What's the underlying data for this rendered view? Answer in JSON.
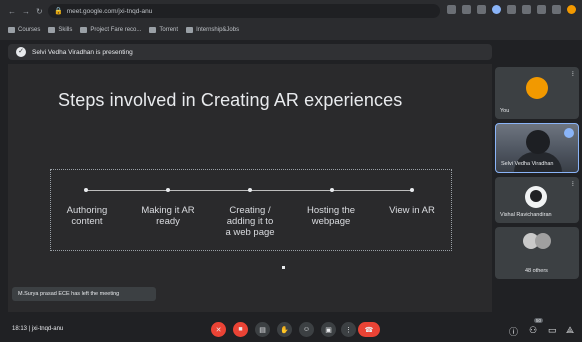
{
  "browser": {
    "url": "meet.google.com/jxi-tnqd-anu",
    "bookmarks": [
      "Courses",
      "Skills",
      "Project Fare reco...",
      "Torrent",
      "Internship&Jobs"
    ]
  },
  "presenting": {
    "text": "Selvi Vedha Viradhan is presenting"
  },
  "slide": {
    "title": "Steps involved in Creating AR experiences",
    "steps": [
      [
        "Authoring",
        "content"
      ],
      [
        "Making it AR",
        "ready"
      ],
      [
        "Creating /",
        "adding it to",
        "a web page"
      ],
      [
        "Hosting the",
        "webpage"
      ],
      [
        "View in AR"
      ]
    ]
  },
  "participants": {
    "you_label": "You",
    "speaker_name": "Selvi Vedha Viradhan",
    "third_name": "Vishal Ravichandiran",
    "others_label": "48 others"
  },
  "toast": {
    "text": "M.Surya prasad ECE has left the meeting"
  },
  "bottom": {
    "time_code": "18:13  |  jxi-tnqd-anu",
    "participant_badge": "50"
  }
}
